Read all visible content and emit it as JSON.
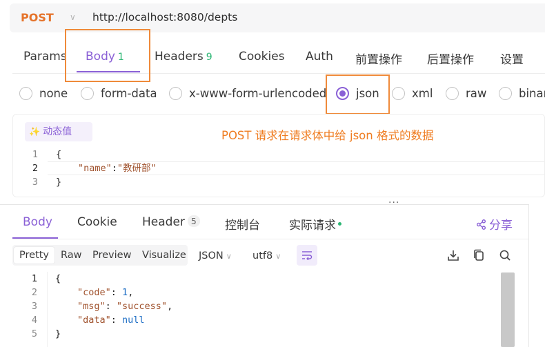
{
  "request": {
    "method": "POST",
    "url": "http://localhost:8080/depts",
    "tabs": [
      {
        "label": "Params",
        "count": ""
      },
      {
        "label": "Body",
        "count": "1"
      },
      {
        "label": "Headers",
        "count": "9"
      },
      {
        "label": "Cookies",
        "count": ""
      },
      {
        "label": "Auth",
        "count": ""
      },
      {
        "label": "前置操作",
        "count": ""
      },
      {
        "label": "后置操作",
        "count": ""
      },
      {
        "label": "设置",
        "count": ""
      }
    ],
    "body_types": [
      "none",
      "form-data",
      "x-www-form-urlencoded",
      "json",
      "xml",
      "raw",
      "binar"
    ],
    "selected_body_type": "json",
    "dynamic_value_label": "动态值",
    "annotation": "POST 请求在请求体中给 json 格式的数据",
    "code_lines": [
      {
        "n": "1",
        "text": "{"
      },
      {
        "n": "2",
        "key": "\"name\"",
        "sep": ":",
        "value": "\"教研部\""
      },
      {
        "n": "3",
        "text": "}"
      }
    ]
  },
  "response": {
    "tabs": [
      {
        "label": "Body",
        "count": ""
      },
      {
        "label": "Cookie",
        "count": ""
      },
      {
        "label": "Header",
        "count": "5"
      },
      {
        "label": "控制台",
        "count": ""
      },
      {
        "label": "实际请求",
        "count": ""
      }
    ],
    "share_label": "分享",
    "formats": [
      "Pretty",
      "Raw",
      "Preview",
      "Visualize"
    ],
    "selected_format": "Pretty",
    "language": "JSON",
    "encoding": "utf8",
    "code_lines": [
      {
        "n": "1",
        "text": "{"
      },
      {
        "n": "2",
        "key": "\"code\"",
        "sep": ": ",
        "value": "1",
        "trail": ","
      },
      {
        "n": "3",
        "key": "\"msg\"",
        "sep": ": ",
        "value": "\"success\"",
        "trail": ","
      },
      {
        "n": "4",
        "key": "\"data\"",
        "sep": ": ",
        "value": "null",
        "trail": ""
      },
      {
        "n": "5",
        "text": "}"
      }
    ]
  },
  "colors": {
    "accent": "#8a60d6",
    "method": "#e5732a",
    "annotation": "#ef7d22",
    "count_green": "#2bb673"
  }
}
